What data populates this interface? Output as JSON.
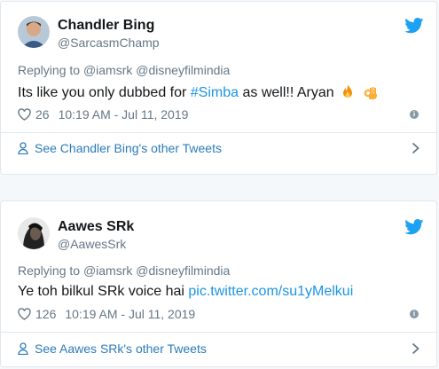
{
  "colors": {
    "link": "#1b95e0",
    "footer_link": "#2b7bb9",
    "muted": "#657786",
    "text": "#14171a",
    "bird": "#1da1f2"
  },
  "tweets": [
    {
      "author_name": "Chandler Bing",
      "author_handle": "@SarcasmChamp",
      "replying_label": "Replying to",
      "mentions": [
        "@iamsrk",
        "@disneyfilmindia"
      ],
      "text_before": "Its like you only dubbed for ",
      "hashtag": "#Simba",
      "text_after": " as well!! Aryan",
      "emojis": [
        "fire-emoji",
        "ok-hand-emoji"
      ],
      "likes": "26",
      "timestamp": "10:19 AM - Jul 11, 2019",
      "footer_link": "See Chandler Bing's other Tweets"
    },
    {
      "author_name": "Aawes SRk",
      "author_handle": "@AawesSrk",
      "replying_label": "Replying to",
      "mentions": [
        "@iamsrk",
        "@disneyfilmindia"
      ],
      "text_before": "Ye toh bilkul SRk voice hai ",
      "link": "pic.twitter.com/su1yMelkui",
      "likes": "126",
      "timestamp": "10:19 AM - Jul 11, 2019",
      "footer_link": "See Aawes SRk's other Tweets"
    }
  ],
  "icons": {
    "brand": "twitter-bird-icon",
    "like": "heart-icon",
    "info": "info-icon",
    "profile": "person-icon",
    "next": "chevron-right-icon"
  }
}
